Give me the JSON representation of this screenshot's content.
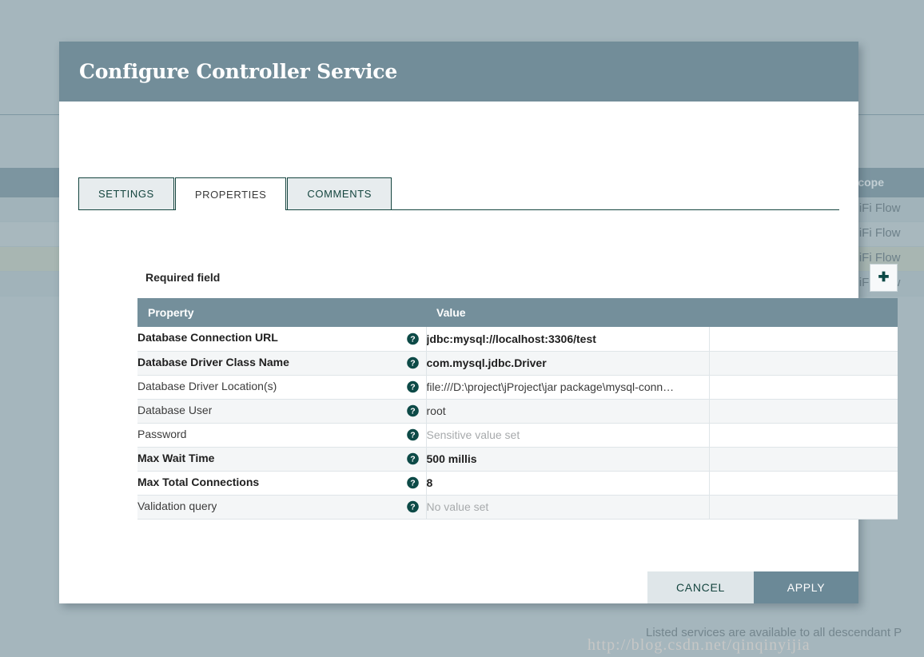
{
  "background": {
    "table_header_scope": "Scope",
    "rows": [
      {
        "scope": "NiFi Flow"
      },
      {
        "scope": "NiFi Flow"
      },
      {
        "scope": "NiFi Flow"
      },
      {
        "scope": "NiFi Flow"
      }
    ],
    "footnote": "Listed services are available to all descendant P",
    "watermark": "http://blog.csdn.net/qinqinyijia"
  },
  "dialog": {
    "title": "Configure Controller Service",
    "tabs": [
      {
        "label": "SETTINGS",
        "active": false
      },
      {
        "label": "PROPERTIES",
        "active": true
      },
      {
        "label": "COMMENTS",
        "active": false
      }
    ],
    "required_note": "Required field",
    "add_button": {
      "icon": "plus-icon",
      "label": "+"
    },
    "table": {
      "columns": [
        "Property",
        "Value",
        ""
      ],
      "rows": [
        {
          "property": "Database Connection URL",
          "required": true,
          "value": "jdbc:mysql://localhost:3306/test",
          "value_state": "set"
        },
        {
          "property": "Database Driver Class Name",
          "required": true,
          "value": "com.mysql.jdbc.Driver",
          "value_state": "set"
        },
        {
          "property": "Database Driver Location(s)",
          "required": false,
          "value": "file:///D:\\project\\jProject\\jar package\\mysql-conn…",
          "value_state": "set"
        },
        {
          "property": "Database User",
          "required": false,
          "value": "root",
          "value_state": "set"
        },
        {
          "property": "Password",
          "required": false,
          "value": "Sensitive value set",
          "value_state": "unset"
        },
        {
          "property": "Max Wait Time",
          "required": true,
          "value": "500 millis",
          "value_state": "set"
        },
        {
          "property": "Max Total Connections",
          "required": true,
          "value": "8",
          "value_state": "set"
        },
        {
          "property": "Validation query",
          "required": false,
          "value": "No value set",
          "value_state": "unset"
        }
      ]
    },
    "buttons": {
      "cancel": "CANCEL",
      "apply": "APPLY"
    }
  },
  "colors": {
    "header_bar": "#728d99",
    "table_header": "#748f9b",
    "accent_teal": "#15453f",
    "apply_button": "#6b8997",
    "cancel_button": "#dfe6e9",
    "page_backdrop": "#a5b6bd"
  }
}
